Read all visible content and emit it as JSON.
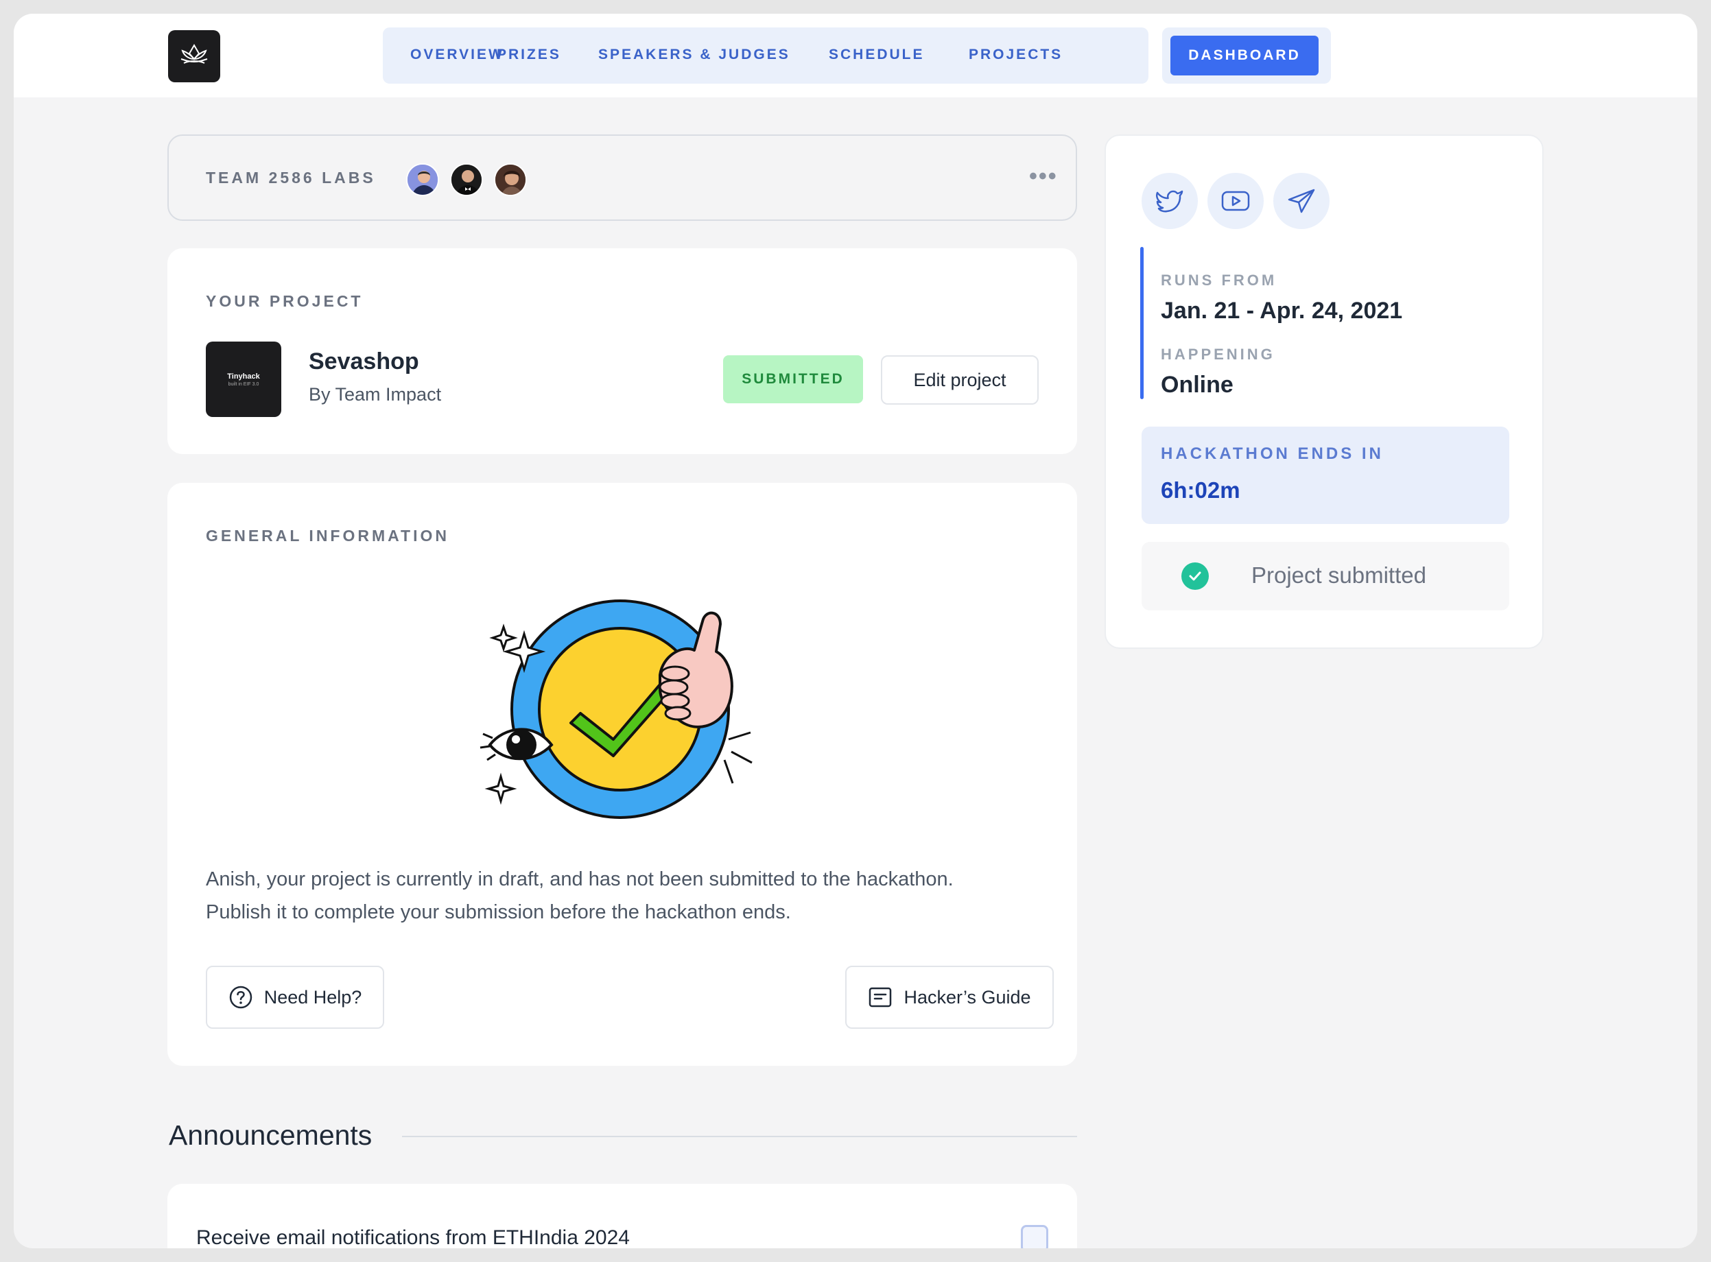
{
  "nav": {
    "items": [
      "OVERVIEW",
      "PRIZES",
      "SPEAKERS & JUDGES",
      "SCHEDULE",
      "PROJECTS"
    ],
    "active": "DASHBOARD"
  },
  "team": {
    "name": "TEAM 2586 LABS",
    "more": "•••"
  },
  "project": {
    "section_label": "YOUR PROJECT",
    "thumb_title": "Tinyhack",
    "thumb_subtitle": "built in EIF 3.0",
    "name": "Sevashop",
    "by": "By Team Impact",
    "status": "SUBMITTED",
    "edit_label": "Edit project"
  },
  "general": {
    "section_label": "GENERAL INFORMATION",
    "message_line1": "Anish, your project is currently in draft, and has not been submitted to the hackathon.",
    "message_line2": "Publish it to complete your submission before the hackathon ends.",
    "help_label": "Need Help?",
    "guide_label": "Hacker’s Guide"
  },
  "announcements": {
    "title": "Announcements",
    "notif_text": "Receive email notifications from ETHIndia 2024",
    "notif_checked": false
  },
  "sidebar": {
    "social_icons": [
      "twitter-icon",
      "youtube-icon",
      "telegram-icon"
    ],
    "runs_label": "RUNS FROM",
    "runs_value": "Jan. 21 - Apr. 24, 2021",
    "happening_label": "HAPPENING",
    "happening_value": "Online",
    "ends_label": "HACKATHON ENDS IN",
    "ends_value": "6h:02m",
    "submitted_text": "Project submitted"
  },
  "colors": {
    "accent": "#3a6cf0",
    "nav_bg": "#eaf0fb",
    "success_bg": "#b7f5c3",
    "success_text": "#1f8a3c",
    "check": "#22c29a"
  }
}
